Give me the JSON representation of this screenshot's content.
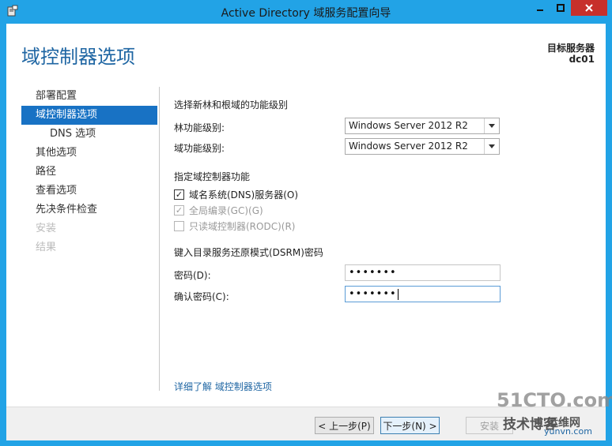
{
  "window": {
    "title": "Active Directory 域服务配置向导",
    "app_icon": "server-manager-icon"
  },
  "header": {
    "page_title": "域控制器选项",
    "target_server_label": "目标服务器",
    "target_server_value": "dc01"
  },
  "nav": {
    "items": [
      {
        "label": "部署配置",
        "state": "normal"
      },
      {
        "label": "域控制器选项",
        "state": "active"
      },
      {
        "label": "DNS 选项",
        "state": "sub"
      },
      {
        "label": "其他选项",
        "state": "normal"
      },
      {
        "label": "路径",
        "state": "normal"
      },
      {
        "label": "查看选项",
        "state": "normal"
      },
      {
        "label": "先决条件检查",
        "state": "normal"
      },
      {
        "label": "安装",
        "state": "disabled"
      },
      {
        "label": "结果",
        "state": "disabled"
      }
    ]
  },
  "content": {
    "functional_level_section": "选择新林和根域的功能级别",
    "forest_level_label": "林功能级别:",
    "forest_level_value": "Windows Server 2012 R2",
    "domain_level_label": "域功能级别:",
    "domain_level_value": "Windows Server 2012 R2",
    "capabilities_section": "指定域控制器功能",
    "dns_checkbox": "域名系统(DNS)服务器(O)",
    "gc_checkbox": "全局编录(GC)(G)",
    "rodc_checkbox": "只读域控制器(RODC)(R)",
    "dsrm_section": "键入目录服务还原模式(DSRM)密码",
    "password_label": "密码(D):",
    "password_value": "•••••••",
    "confirm_label": "确认密码(C):",
    "confirm_value": "•••••••",
    "more_link": "详细了解 域控制器选项"
  },
  "footer": {
    "back_button": "< 上一步(P)",
    "next_button": "下一步(N) >",
    "install_button": "安装"
  },
  "watermark": {
    "line1": "51CTO.com",
    "line2": "技术博客",
    "line3": "运维网",
    "line4": "yunvn.com"
  },
  "colors": {
    "window_frame": "#22a3e6",
    "close_button": "#c7302b",
    "active_nav": "#1872c4",
    "title_blue": "#1f66a3"
  }
}
